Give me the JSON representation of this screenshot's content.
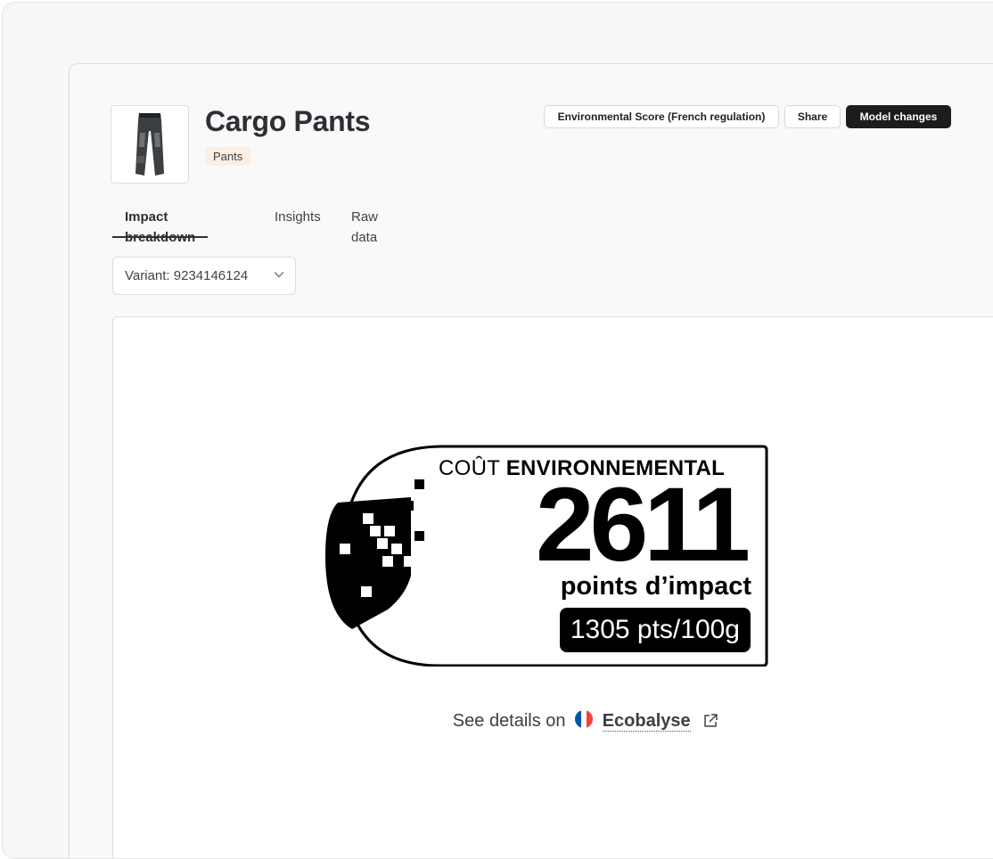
{
  "product": {
    "title": "Cargo Pants",
    "category_tag": "Pants",
    "image_icon": "pants-icon"
  },
  "header_actions": {
    "env_score_label": "Environmental Score (French regulation)",
    "share_label": "Share",
    "model_changes_label": "Model changes"
  },
  "tabs": [
    {
      "label": "Impact breakdown",
      "active": true
    },
    {
      "label": "Insights",
      "active": false
    },
    {
      "label": "Raw data",
      "active": false
    }
  ],
  "variant_select": {
    "value": "Variant: 9234146124",
    "icon": "chevron-down-icon"
  },
  "env_label": {
    "title_light": "COÛT",
    "title_bold": "ENVIRONNEMENTAL",
    "score": "2611",
    "unit": "points d’impact",
    "per_100g": "1305 pts/100g"
  },
  "details": {
    "prefix": "See details on",
    "link_text": "Ecobalyse",
    "flag_icon": "french-flag-icon",
    "external_icon": "external-link-icon"
  },
  "colors": {
    "primary_button": "#1c1c1c",
    "tag_bg": "#fdeee4",
    "flag_blue": "#0055a4",
    "flag_red": "#ef4135"
  }
}
